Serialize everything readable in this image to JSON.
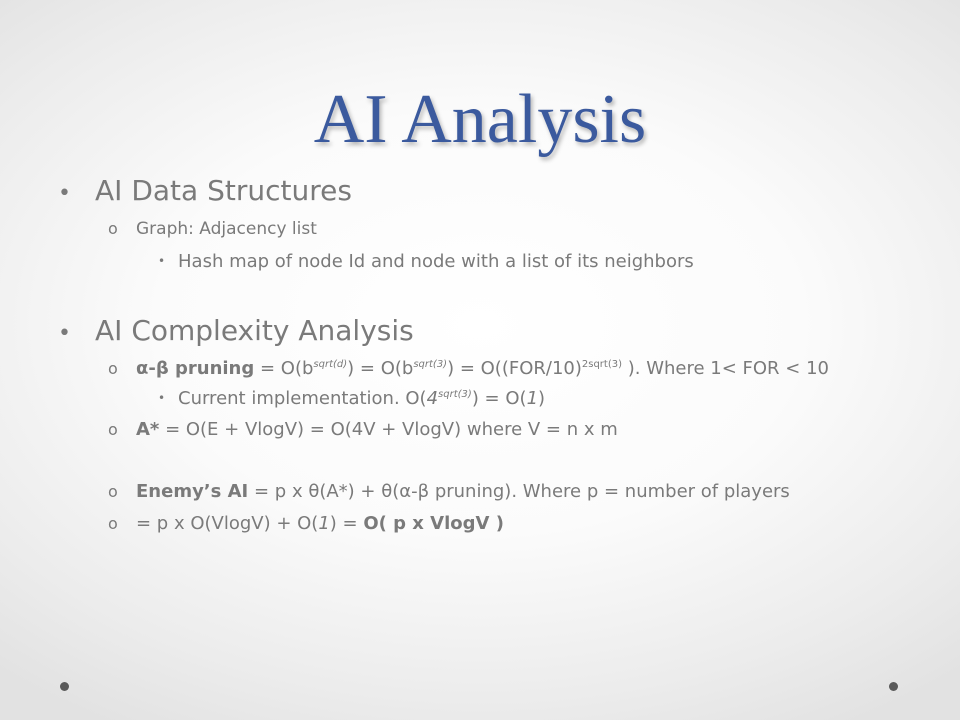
{
  "slide": {
    "title": "AI Analysis",
    "s1": {
      "bullet": "•",
      "text": "AI Data Structures",
      "sub": {
        "bullet": "o",
        "text": "Graph: Adjacency list",
        "subsub": {
          "bullet": "•",
          "text": "Hash map of node Id and node with a list of its neighbors"
        }
      }
    },
    "s2": {
      "bullet": "•",
      "text": "AI Complexity Analysis",
      "ab": {
        "bullet": "o",
        "label": "α-β pruning",
        "p1": " = O(b",
        "sup1": "sqrt(d)",
        "p2": ") = O(b",
        "sup2": "sqrt(3)",
        "p3": ") = O((FOR/10)",
        "sup3": "2sqrt(3)",
        "p4": " ). Where 1< FOR < 10",
        "cur": {
          "bullet": "•",
          "p1": "Current implementation. O(",
          "it1": "4",
          "sup": "sqrt(3)",
          "p2": ") = O(",
          "it2": "1",
          "p3": ")"
        }
      },
      "astar": {
        "bullet": "o",
        "label": "A*",
        "text": " = O(E + VlogV) = O(4V + VlogV) where V = n x m"
      },
      "enemy": {
        "bullet": "o",
        "label": "Enemy’s AI",
        "text": " = p x θ(A*) + θ(α-β pruning).  Where p = number of players"
      },
      "res": {
        "bullet": "o",
        "p1": "= p x O(VlogV) + O(",
        "it": "1",
        "p2": ") = ",
        "strong": "O( p x VlogV )"
      }
    }
  }
}
